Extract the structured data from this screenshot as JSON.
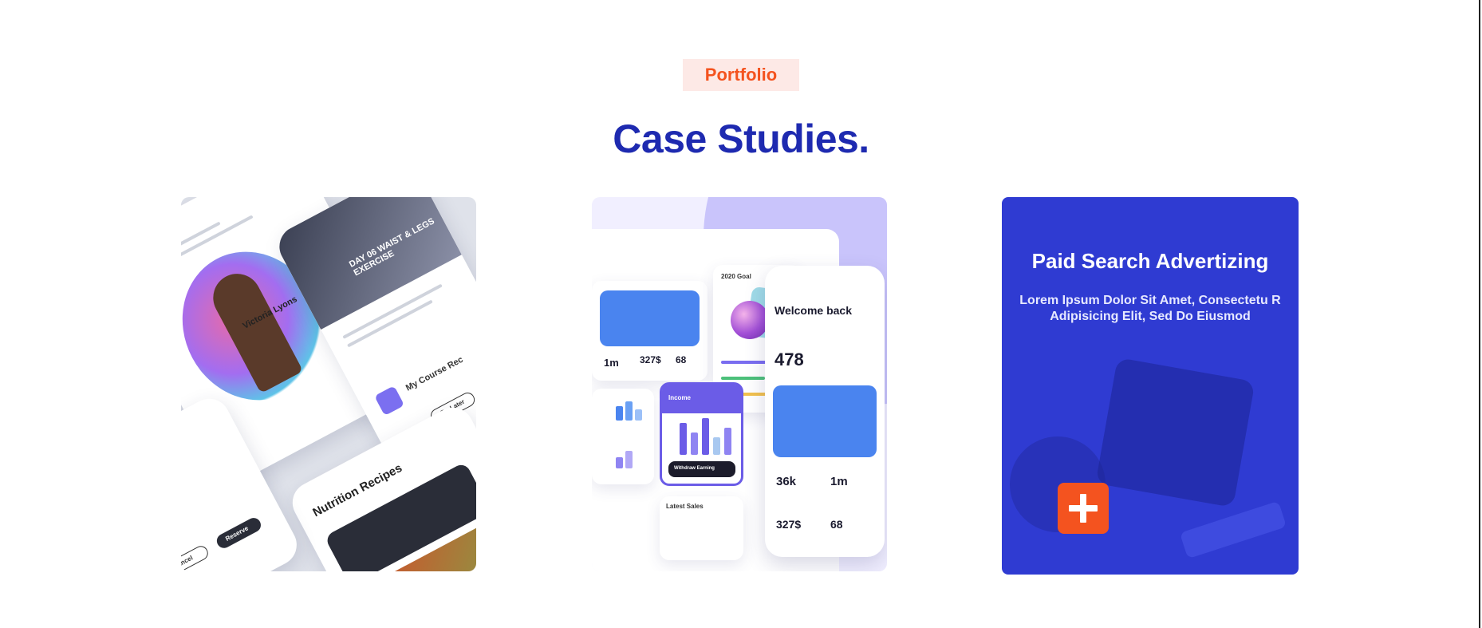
{
  "section": {
    "tag": "Portfolio",
    "heading": "Case Studies."
  },
  "cards": [
    {
      "image_texts": {
        "person_name": "Victoria Lyons",
        "workout": "DAY 06\nWAIST & LEGS EXERCISE",
        "recipes": "Nutrition Recipes",
        "course": "My Course Rec",
        "cancel": "Cancel",
        "reserve": "Reserve",
        "do_later": "Do Later"
      }
    },
    {
      "image_texts": {
        "welcome": "Welcome back",
        "active_users": "478",
        "stat_a": "327$",
        "stat_b": "68",
        "stat_c": "36k",
        "stat_d": "1m",
        "income": "Income",
        "withdraw": "Withdraw Earning",
        "latest_sales": "Latest Sales",
        "goal": "2020 Goal"
      }
    },
    {
      "title": "Paid Search Advertizing",
      "description": "Lorem Ipsum Dolor Sit Amet, Consectetu R Adipisicing Elit, Sed Do Eiusmod",
      "action_icon": "plus-icon"
    }
  ],
  "colors": {
    "accent_orange": "#f4531f",
    "tag_bg": "#fde9e6",
    "heading_blue": "#1e2ab0",
    "card_blue": "#2f3bd2"
  }
}
